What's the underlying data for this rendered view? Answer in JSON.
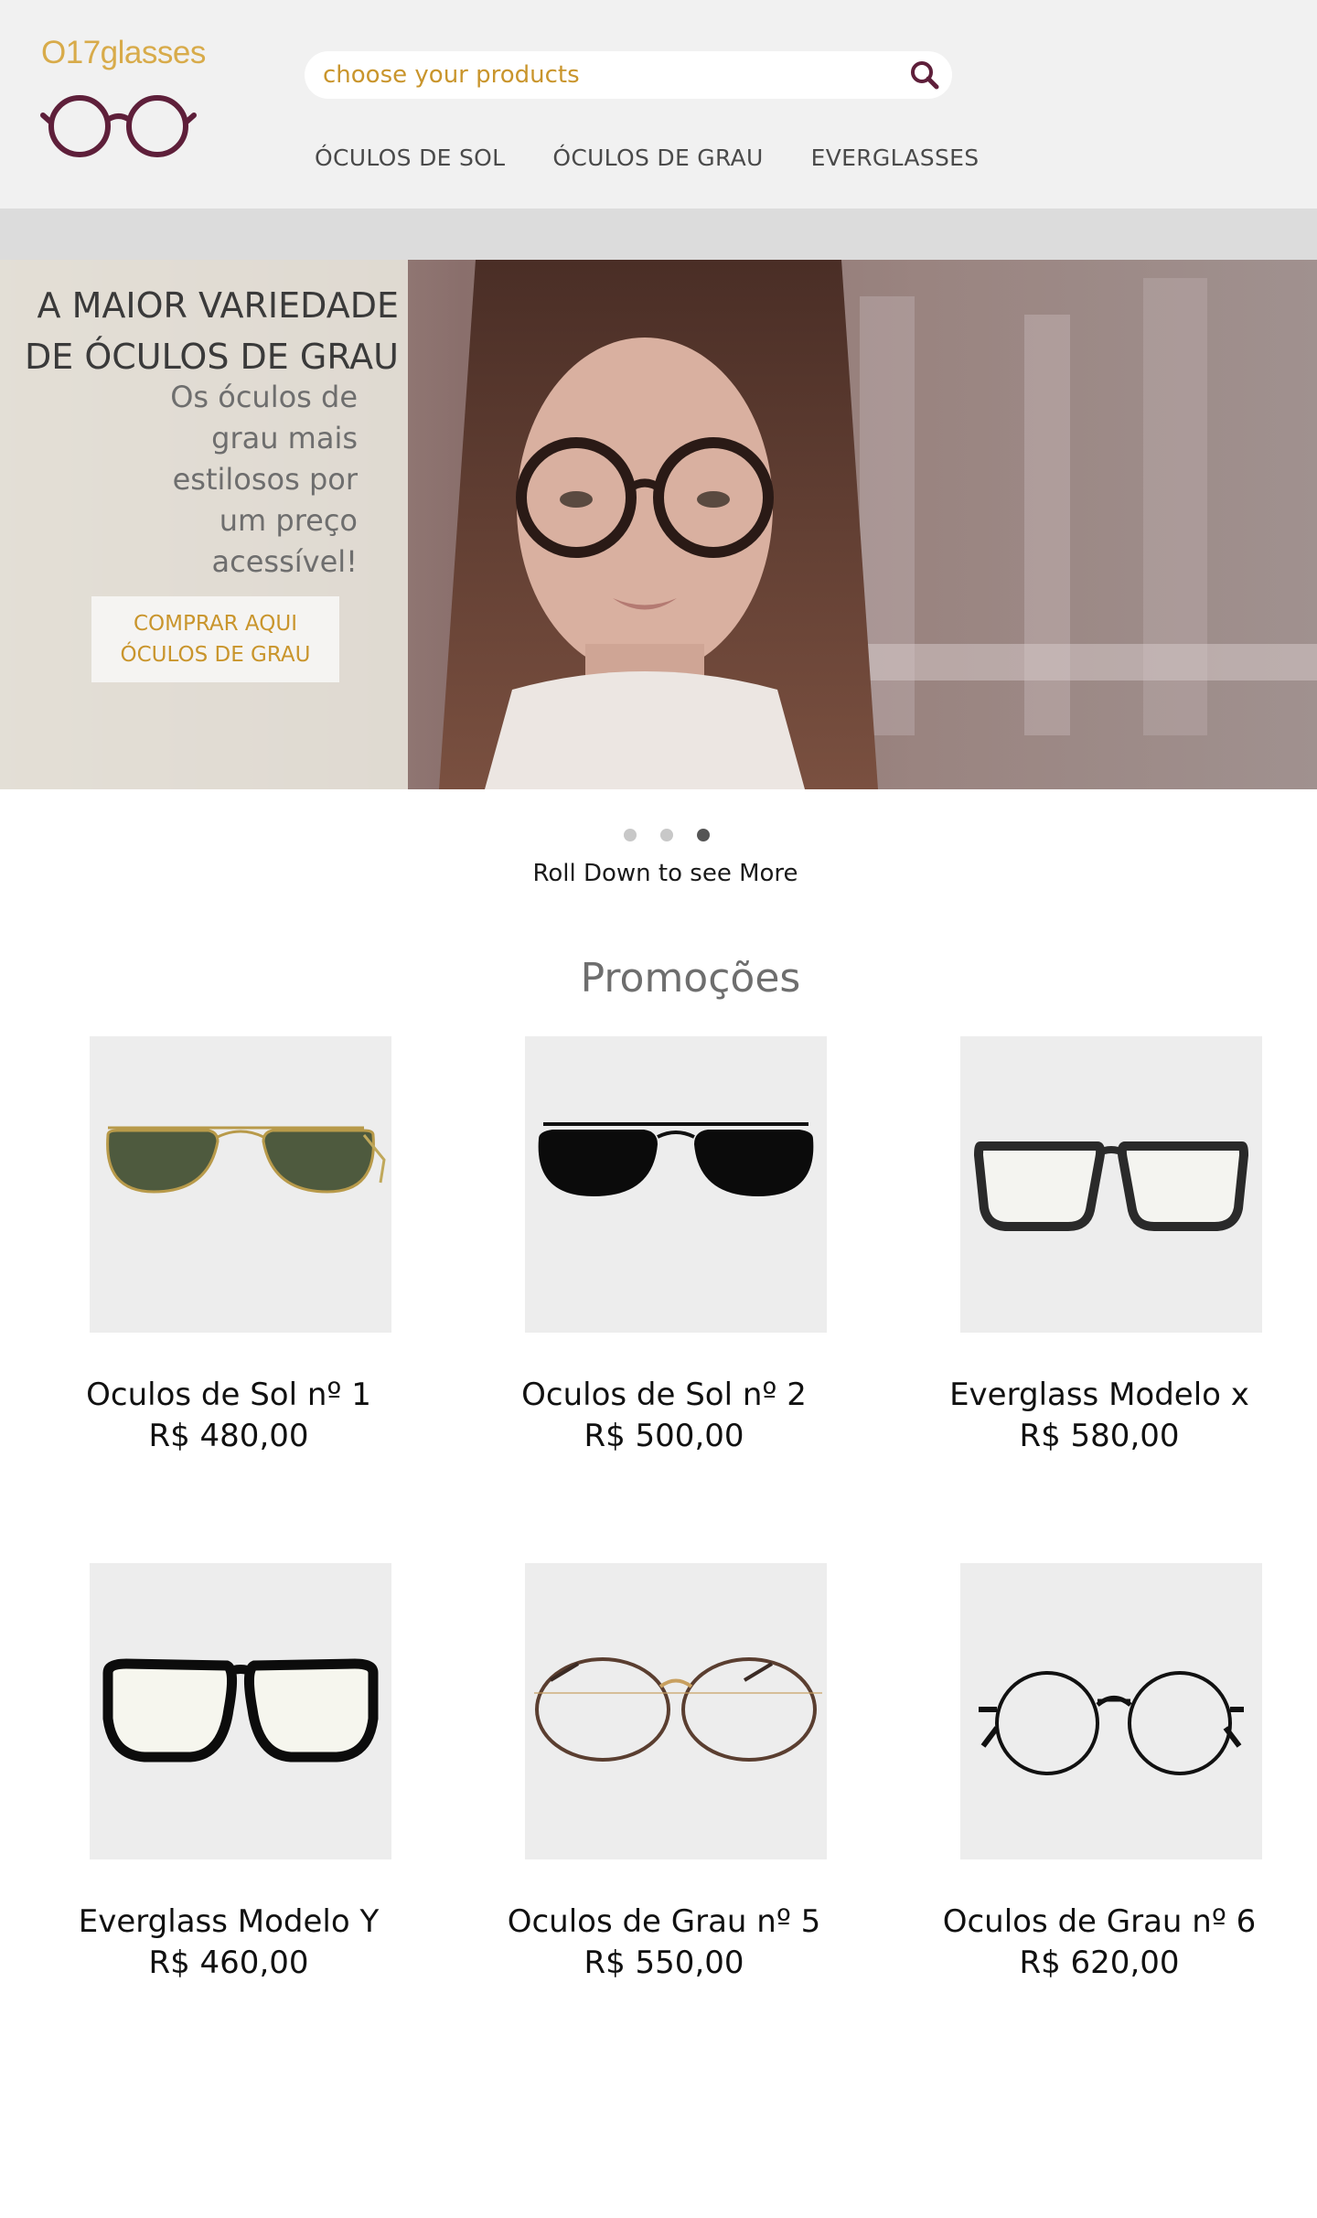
{
  "brand": {
    "logo_text": "O17glasses"
  },
  "search": {
    "placeholder": "choose your products"
  },
  "nav": {
    "items": [
      "ÓCULOS DE SOL",
      "ÓCULOS DE GRAU",
      "EVERGLASSES"
    ]
  },
  "hero": {
    "title": "A MAIOR VARIEDADE DE ÓCULOS DE GRAU",
    "subtitle": "Os óculos de grau mais estilosos por um preço acessível!",
    "cta": "COMPRAR AQUI ÓCULOS DE GRAU"
  },
  "carousel": {
    "active_index": 2,
    "count": 3
  },
  "roll_text": "Roll Down to see More",
  "promotions": {
    "title": "Promoções",
    "products": [
      {
        "name": "Oculos de Sol nº 1",
        "price": "R$ 480,00",
        "image": "aviator-green-gold"
      },
      {
        "name": "Oculos de Sol nº 2",
        "price": "R$ 500,00",
        "image": "aviator-black"
      },
      {
        "name": "Everglass Modelo x",
        "price": "R$ 580,00",
        "image": "square-black-clear"
      },
      {
        "name": "Everglass Modelo Y",
        "price": "R$ 460,00",
        "image": "sport-black-clear"
      },
      {
        "name": "Oculos de Grau nº 5",
        "price": "R$ 550,00",
        "image": "round-gold-thin"
      },
      {
        "name": "Oculos de Grau nº 6",
        "price": "R$ 620,00",
        "image": "round-black-thin"
      }
    ]
  },
  "colors": {
    "brand_gold": "#d8ab4a",
    "brand_maroon": "#5e1f3a",
    "header_bg": "#f1f1f1"
  }
}
